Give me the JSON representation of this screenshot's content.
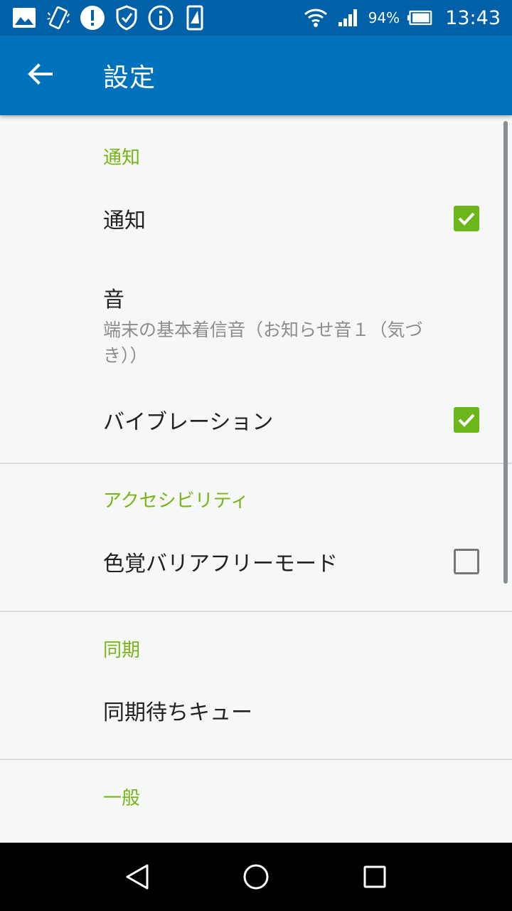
{
  "status_bar": {
    "icons_left": [
      "image-icon",
      "vibrate-icon",
      "alert-icon",
      "shield-check-icon",
      "info-icon",
      "phone-card-icon"
    ],
    "wifi_icon": "wifi-icon",
    "signal_icon": "signal-icon",
    "battery_percent": "94%",
    "time": "13:43"
  },
  "app_bar": {
    "title": "設定",
    "back_icon": "arrow-back-icon"
  },
  "sections": {
    "notify": {
      "header": "通知",
      "notify_title": "通知",
      "notify_checked": true,
      "sound_title": "音",
      "sound_summary": "端末の基本着信音（お知らせ音１（気づき））",
      "vibration_title": "バイブレーション",
      "vibration_checked": true
    },
    "accessibility": {
      "header": "アクセシビリティ",
      "colorblind_title": "色覚バリアフリーモード",
      "colorblind_checked": false
    },
    "sync": {
      "header": "同期",
      "queue_title": "同期待ちキュー"
    },
    "general": {
      "header": "一般"
    }
  },
  "colors": {
    "status_bar": "#0060a8",
    "app_bar": "#0072bc",
    "accent": "#7ab317",
    "checkbox": "#6cb51a"
  },
  "nav_bar": {
    "back": "nav-back-icon",
    "home": "nav-home-icon",
    "recents": "nav-recents-icon"
  }
}
